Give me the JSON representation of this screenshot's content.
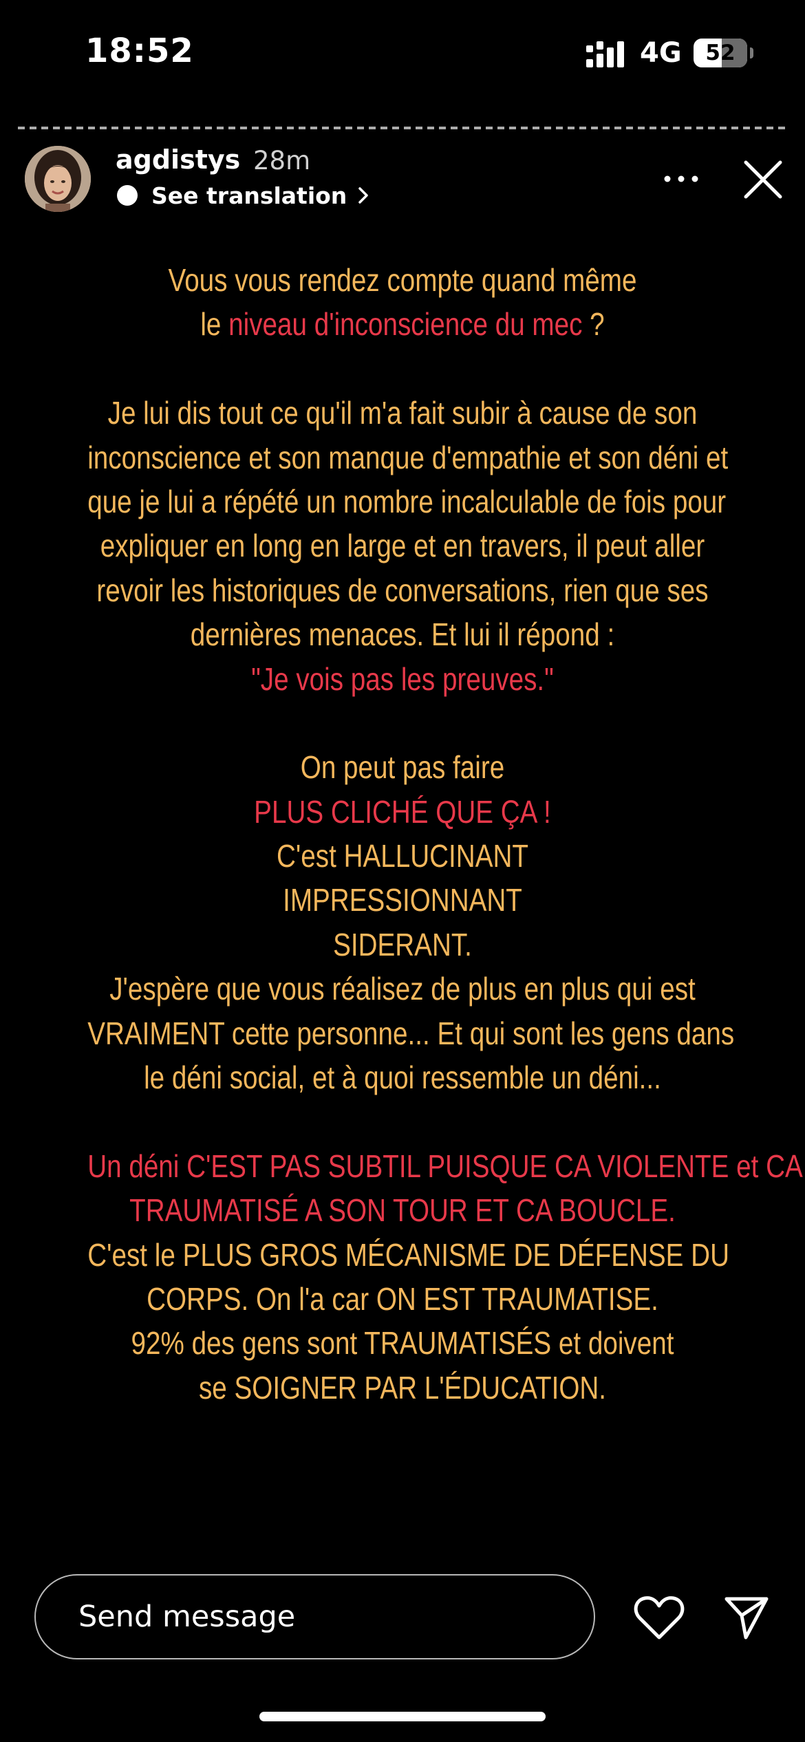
{
  "status_bar": {
    "time": "18:52",
    "network": "4G",
    "battery_level": "52",
    "icons": [
      "signal-icon",
      "battery-icon"
    ]
  },
  "story": {
    "progress_segments": 60,
    "username": "agdistys",
    "time_ago": "28m",
    "translate_label": "See translation",
    "icons": [
      "translate-icon",
      "chevron-right-icon",
      "more-icon",
      "close-icon"
    ],
    "colors": {
      "text": "#f4b75c",
      "highlight": "#e8394a",
      "background": "#000000"
    },
    "lines": [
      [
        {
          "t": "Vous vous rendez compte quand même",
          "hl": false
        }
      ],
      [
        {
          "t": "le ",
          "hl": false
        },
        {
          "t": "niveau d'inconscience du mec",
          "hl": true
        },
        {
          "t": " ?",
          "hl": false
        }
      ],
      [],
      [
        {
          "t": "Je lui dis tout ce qu'il m'a fait subir à cause de son",
          "hl": false
        }
      ],
      [
        {
          "t": "inconscience et son manque d'empathie et son déni et",
          "hl": false
        }
      ],
      [
        {
          "t": "que je lui a répété un nombre incalculable de fois pour",
          "hl": false
        }
      ],
      [
        {
          "t": "expliquer en long en large et en travers, il peut aller",
          "hl": false
        }
      ],
      [
        {
          "t": "revoir les historiques de conversations, rien que ses",
          "hl": false
        }
      ],
      [
        {
          "t": "dernières menaces. Et lui il répond :",
          "hl": false
        }
      ],
      [
        {
          "t": "\"Je vois pas les preuves.\"",
          "hl": true
        }
      ],
      [],
      [
        {
          "t": "On peut pas faire",
          "hl": false
        }
      ],
      [
        {
          "t": "PLUS CLICHÉ QUE ÇA !",
          "hl": true
        }
      ],
      [
        {
          "t": "C'est HALLUCINANT",
          "hl": false
        }
      ],
      [
        {
          "t": "IMPRESSIONNANT",
          "hl": false
        }
      ],
      [
        {
          "t": "SIDERANT.",
          "hl": false
        }
      ],
      [
        {
          "t": "J'espère que vous réalisez de plus en plus qui est",
          "hl": false
        }
      ],
      [
        {
          "t": "VRAIMENT cette personne... Et qui sont les gens dans",
          "hl": false
        }
      ],
      [
        {
          "t": "le déni social, et à quoi ressemble un déni...",
          "hl": false
        }
      ],
      [],
      [
        {
          "t": "Un déni C'EST PAS SUBTIL PUISQUE CA VIOLENTE et CA",
          "hl": true
        }
      ],
      [
        {
          "t": "TRAUMATISÉ A SON TOUR ET CA BOUCLE.",
          "hl": true
        }
      ],
      [
        {
          "t": "C'est le PLUS GROS MÉCANISME DE DÉFENSE DU",
          "hl": false
        }
      ],
      [
        {
          "t": "CORPS. On l'a car ON EST TRAUMATISE.",
          "hl": false
        }
      ],
      [
        {
          "t": "92% des gens sont TRAUMATISÉS et doivent",
          "hl": false
        }
      ],
      [
        {
          "t": "se SOIGNER PAR L'ÉDUCATION.",
          "hl": false
        }
      ]
    ]
  },
  "footer": {
    "message_placeholder": "Send message",
    "icons": [
      "heart-icon",
      "send-icon"
    ]
  }
}
